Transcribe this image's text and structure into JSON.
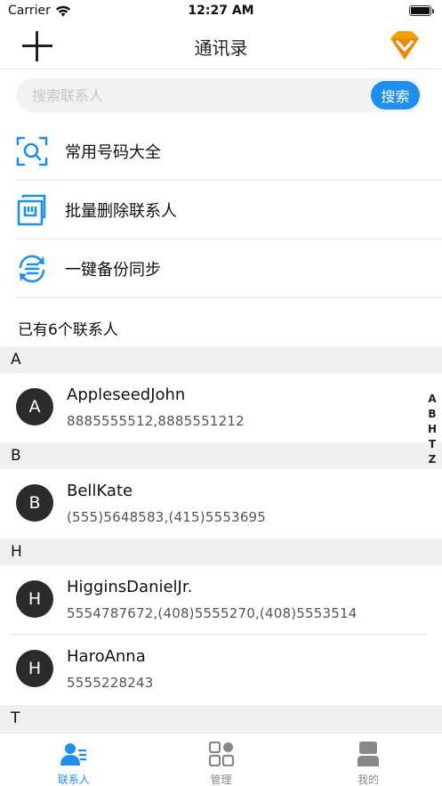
{
  "status_bar": {
    "carrier": "Carrier",
    "time": "12:27 AM"
  },
  "nav": {
    "title": "通讯录"
  },
  "search": {
    "placeholder": "搜索联系人",
    "button_label": "搜索"
  },
  "menu": [
    {
      "label": "常用号码大全",
      "icon": "scan-search-icon"
    },
    {
      "label": "批量删除联系人",
      "icon": "batch-delete-icon"
    },
    {
      "label": "一键备份同步",
      "icon": "sync-icon"
    }
  ],
  "contact_count": "已有6个联系人",
  "sections": [
    {
      "letter": "A",
      "contacts": [
        {
          "initial": "A",
          "name": "AppleseedJohn",
          "phone": "8885555512,8885551212"
        }
      ]
    },
    {
      "letter": "B",
      "contacts": [
        {
          "initial": "B",
          "name": "BellKate",
          "phone": "(555)5648583,(415)5553695"
        }
      ]
    },
    {
      "letter": "H",
      "contacts": [
        {
          "initial": "H",
          "name": "HigginsDanielJr.",
          "phone": "5554787672,(408)5555270,(408)5553514"
        },
        {
          "initial": "H",
          "name": "HaroAnna",
          "phone": "5555228243"
        }
      ]
    },
    {
      "letter": "T",
      "contacts": []
    }
  ],
  "index_letters": [
    "A",
    "B",
    "H",
    "T",
    "Z"
  ],
  "tabs": [
    {
      "label": "联系人",
      "icon": "contacts-icon",
      "active": true
    },
    {
      "label": "管理",
      "icon": "grid-icon",
      "active": false
    },
    {
      "label": "我的",
      "icon": "profile-icon",
      "active": false
    }
  ],
  "colors": {
    "accent": "#1e8ff0",
    "vip_orange": "#f5a000",
    "avatar": "#2b2b2b"
  }
}
